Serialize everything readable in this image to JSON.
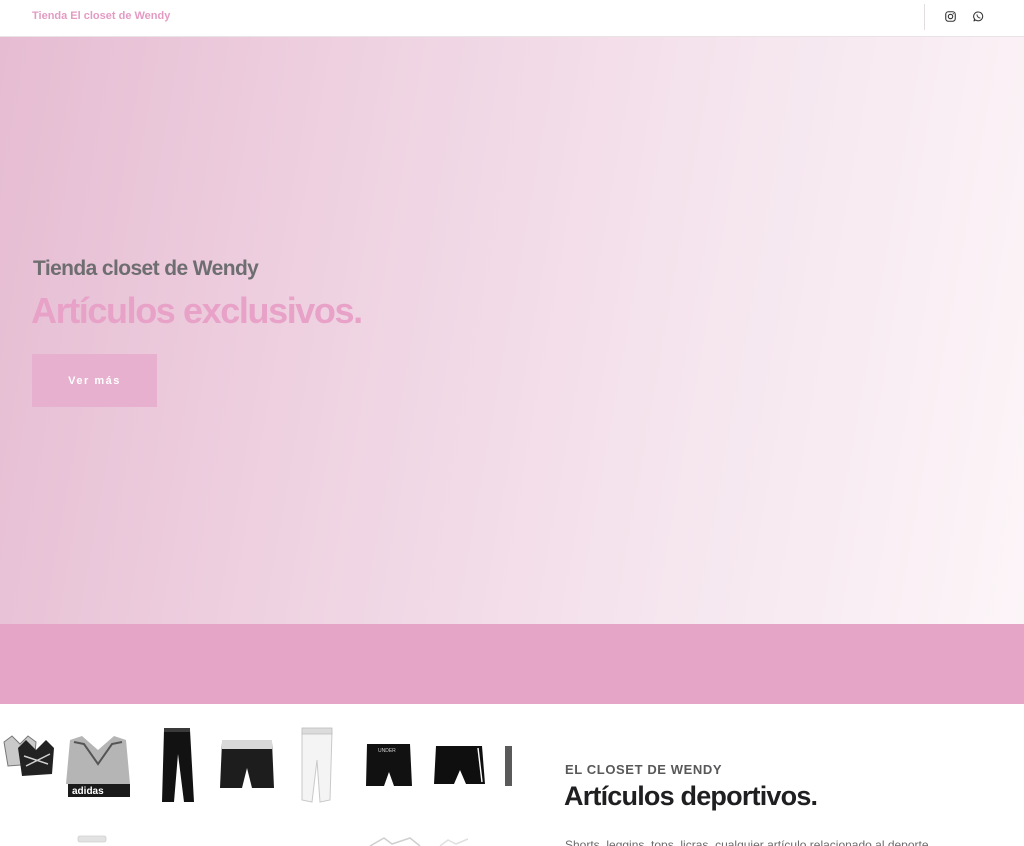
{
  "header": {
    "brand": "Tienda El closet de Wendy",
    "social": [
      {
        "icon": "instagram-icon"
      },
      {
        "icon": "whatsapp-icon"
      }
    ]
  },
  "hero": {
    "subtitle": "Tienda closet de Wendy",
    "title": "Artículos exclusivos.",
    "button_label": "Ver más"
  },
  "about": {
    "kicker": "EL CLOSET DE WENDY",
    "title": "Artículos deportivos.",
    "text": "Shorts, leggins, tops, licras, cualquier artículo relacionado al deporte"
  },
  "colors": {
    "brand": "#e39bc3",
    "hero_title": "#e8a2c8",
    "button": "#e7b0ce",
    "band": "#e4a5c6"
  }
}
